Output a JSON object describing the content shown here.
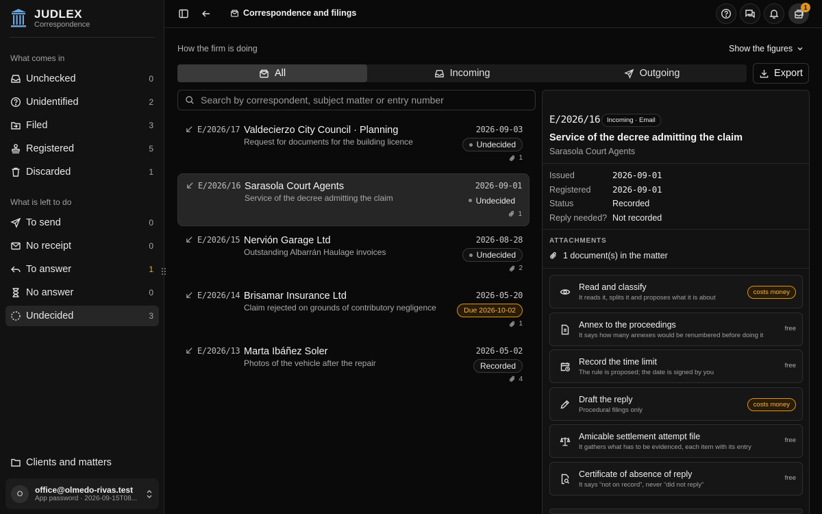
{
  "brand": {
    "title": "JUDLEX",
    "subtitle": "Correspondence"
  },
  "sidebar": {
    "section_in": "What comes in",
    "in_items": [
      {
        "label": "Unchecked",
        "count": "0",
        "icon": "inbox-icon"
      },
      {
        "label": "Unidentified",
        "count": "2",
        "icon": "question-circle-icon"
      },
      {
        "label": "Filed",
        "count": "3",
        "icon": "folder-in-icon"
      },
      {
        "label": "Registered",
        "count": "5",
        "icon": "stamp-icon"
      },
      {
        "label": "Discarded",
        "count": "1",
        "icon": "trash-icon"
      }
    ],
    "section_todo": "What is left to do",
    "todo_items": [
      {
        "label": "To send",
        "count": "0",
        "icon": "send-icon"
      },
      {
        "label": "No receipt",
        "count": "0",
        "icon": "mail-icon"
      },
      {
        "label": "To answer",
        "count": "1",
        "icon": "reply-icon"
      },
      {
        "label": "No answer",
        "count": "0",
        "icon": "hourglass-icon"
      },
      {
        "label": "Undecided",
        "count": "3",
        "icon": "dashed-circle-icon"
      }
    ],
    "clients": "Clients and matters",
    "account": {
      "initial": "O",
      "email": "office@olmedo-rivas.test",
      "sub": "App password · 2026-09-15T08..."
    }
  },
  "topbar": {
    "breadcrumb": "Correspondence and filings",
    "notifications_badge": "1"
  },
  "main": {
    "subheading": "How the firm is doing",
    "show_figures": "Show the figures",
    "tabs": [
      {
        "label": "All"
      },
      {
        "label": "Incoming"
      },
      {
        "label": "Outgoing"
      }
    ],
    "export": "Export",
    "search_placeholder": "Search by correspondent, subject matter or entry number"
  },
  "entries": [
    {
      "ref": "E/2026/17",
      "who": "Valdecierzo City Council · Planning",
      "subject": "Request for documents for the building licence",
      "date": "2026-09-03",
      "status": "Undecided",
      "attachments": "1"
    },
    {
      "ref": "E/2026/16",
      "who": "Sarasola Court Agents",
      "subject": "Service of the decree admitting the claim",
      "date": "2026-09-01",
      "status": "Undecided",
      "attachments": "1"
    },
    {
      "ref": "E/2026/15",
      "who": "Nervión Garage Ltd",
      "subject": "Outstanding Albarrán Haulage invoices",
      "date": "2026-08-28",
      "status": "Undecided",
      "attachments": "2"
    },
    {
      "ref": "E/2026/14",
      "who": "Brisamar Insurance Ltd",
      "subject": "Claim rejected on grounds of contributory negligence",
      "date": "2026-05-20",
      "status": "Due 2026-10-02",
      "attachments": "1"
    },
    {
      "ref": "E/2026/13",
      "who": "Marta Ibáñez Soler",
      "subject": "Photos of the vehicle after the repair",
      "date": "2026-05-02",
      "status": "Recorded",
      "attachments": "4"
    }
  ],
  "detail": {
    "ref": "E/2026/16",
    "tag": "Incoming · Email",
    "title": "Service of the decree admitting the claim",
    "from": "Sarasola Court Agents",
    "fields": [
      {
        "k": "Issued",
        "v": "2026-09-01"
      },
      {
        "k": "Registered",
        "v": "2026-09-01"
      },
      {
        "k": "Status",
        "v": "Recorded"
      },
      {
        "k": "Reply needed?",
        "v": "Not recorded"
      }
    ],
    "attachments_heading": "ATTACHMENTS",
    "attachments_line": "1 document(s) in the matter",
    "actions": [
      {
        "title": "Read and classify",
        "sub": "It reads it, splits it and proposes what it is about",
        "price": "costs money",
        "icon": "eye-icon"
      },
      {
        "title": "Annex to the proceedings",
        "sub": "It says how many annexes would be renumbered before doing it",
        "price": "free",
        "icon": "document-icon"
      },
      {
        "title": "Record the time limit",
        "sub": "The rule is proposed; the date is signed by you",
        "price": "free",
        "icon": "calendar-clock-icon"
      },
      {
        "title": "Draft the reply",
        "sub": "Procedural filings only",
        "price": "costs money",
        "icon": "pen-icon"
      },
      {
        "title": "Amicable settlement attempt file",
        "sub": "It gathers what has to be evidenced, each item with its entry",
        "price": "free",
        "icon": "scales-icon"
      },
      {
        "title": "Certificate of absence of reply",
        "sub": "It says “not on record”, never “did not reply”",
        "price": "free",
        "icon": "file-search-icon"
      }
    ]
  }
}
